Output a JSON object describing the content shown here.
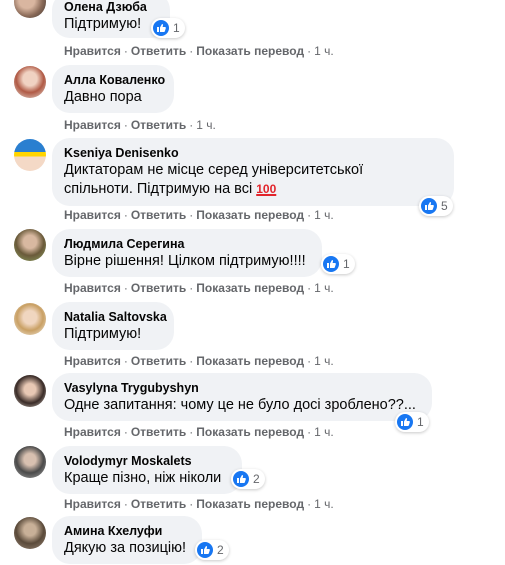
{
  "actions": {
    "like": "Нравится",
    "reply": "Ответить",
    "translate": "Показать перевод",
    "sep": "·"
  },
  "comments": [
    {
      "author": "Олена Дзюба",
      "text": "Підтримую!",
      "time": "1 ч.",
      "reactions": "1"
    },
    {
      "author": "Алла Коваленко",
      "text": "Давно пора",
      "time": "1 ч."
    },
    {
      "author": "Kseniya Denisenko",
      "text_line1": "Диктаторам не місце серед університетської",
      "text_line2": "спільноти. Підтримую на всі",
      "emoji": "100",
      "time": "1 ч.",
      "reactions": "5"
    },
    {
      "author": "Людмила Серегина",
      "text": "Вірне рішення! Цілком підтримую!!!!",
      "time": "1 ч.",
      "reactions": "1"
    },
    {
      "author": "Natalia Saltovska",
      "text": "Підтримую!",
      "time": "1 ч."
    },
    {
      "author": "Vasylyna Trygubyshyn",
      "text": "Одне запитання: чому це не було досі зроблено??...",
      "time": "1 ч.",
      "reactions": "1"
    },
    {
      "author": "Volodymyr Moskalets",
      "text": "Краще пізно, ніж ніколи",
      "time": "1 ч.",
      "reactions": "2"
    },
    {
      "author": "Амина Кхелуфи",
      "text": "Дякую за позицію!",
      "reactions": "2"
    }
  ]
}
